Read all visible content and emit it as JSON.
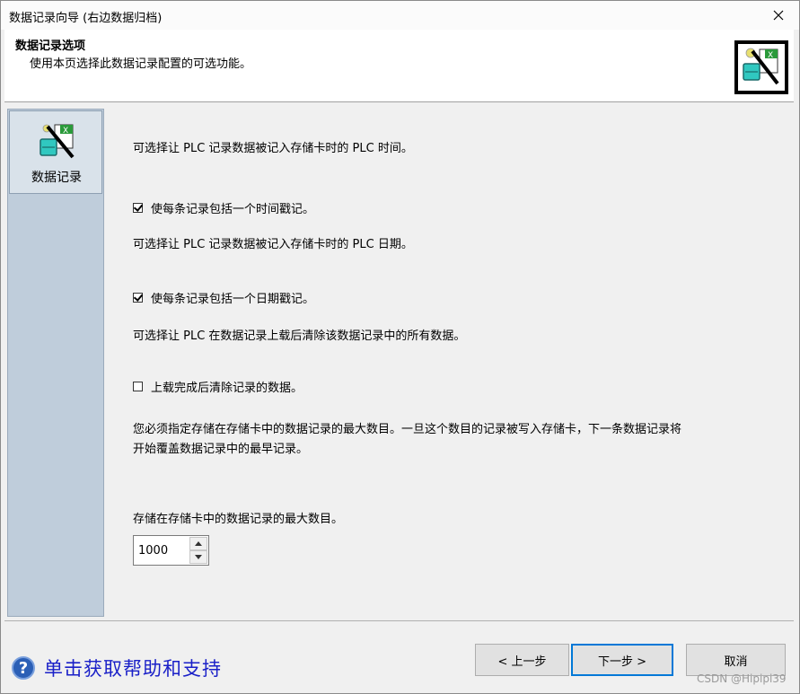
{
  "window": {
    "title": "数据记录向导 (右边数据归档)"
  },
  "header": {
    "title": "数据记录选项",
    "subtitle": "使用本页选择此数据记录配置的可选功能。"
  },
  "sidebar": {
    "items": [
      {
        "label": "数据记录",
        "icon": "data-log-icon"
      }
    ]
  },
  "content": {
    "time_desc": "可选择让 PLC 记录数据被记入存储卡时的 PLC 时间。",
    "time_checkbox": {
      "label": "使每条记录包括一个时间戳记。",
      "checked": true
    },
    "date_desc": "可选择让 PLC 记录数据被记入存储卡时的 PLC 日期。",
    "date_checkbox": {
      "label": "使每条记录包括一个日期戳记。",
      "checked": true
    },
    "clear_desc": "可选择让 PLC 在数据记录上载后清除该数据记录中的所有数据。",
    "clear_checkbox": {
      "label": "上载完成后清除记录的数据。",
      "checked": false
    },
    "max_desc_line1": "您必须指定存储在存储卡中的数据记录的最大数目。一旦这个数目的记录被写入存储卡，下一条数据记录将",
    "max_desc_line2": "开始覆盖数据记录中的最早记录。",
    "max_label": "存储在存储卡中的数据记录的最大数目。",
    "max_value": "1000"
  },
  "footer": {
    "help_label": "单击获取帮助和支持",
    "prev_label": "< 上一步",
    "next_label": "下一步 >",
    "cancel_label": "取消"
  },
  "watermark": "CSDN @Hipipi39",
  "colors": {
    "help_link": "#1a20c8",
    "sidebar_bg": "#bfcddb",
    "focus_border": "#0078d7"
  }
}
